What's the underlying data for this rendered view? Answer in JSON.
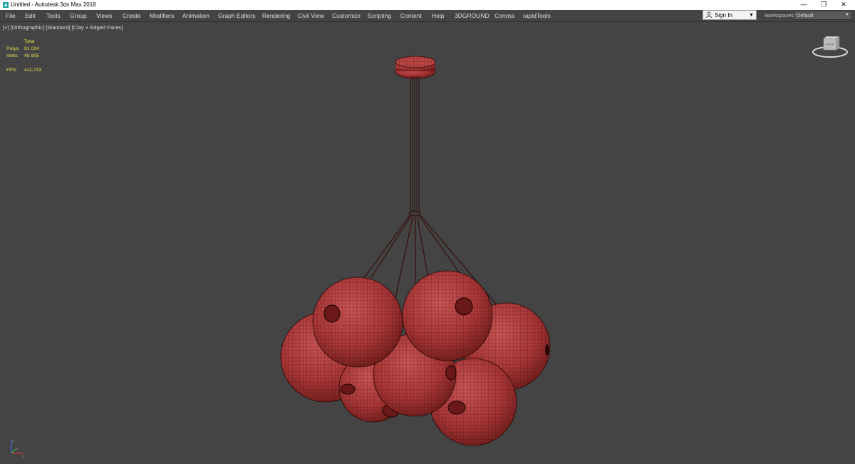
{
  "titlebar": {
    "title": "Untitled - Autodesk 3ds Max 2018",
    "minimize_glyph": "—",
    "restore_glyph": "❐",
    "close_glyph": "✕"
  },
  "menu": {
    "items": [
      "File",
      "Edit",
      "Tools",
      "Group",
      "Views",
      "Create",
      "Modifiers",
      "Animation",
      "Graph Editors",
      "Rendering",
      "Civil View",
      "Customize",
      "Scripting",
      "Content",
      "Help",
      "3DGROUND",
      "Corona",
      "rapidTools"
    ]
  },
  "signin": {
    "label": "Sign In"
  },
  "workspaces": {
    "label": "Workspaces:",
    "value": "Default"
  },
  "viewport": {
    "labels": [
      "[+]",
      "[Orthographic]",
      "[Standard]",
      "[Clay + Edged Faces]"
    ],
    "stats": {
      "header": "Total",
      "polys_label": "Polys:",
      "polys_value": "91 024",
      "verts_label": "Verts:",
      "verts_value": "45 905",
      "fps_label": "FPS:",
      "fps_value": "411,743"
    },
    "viewcube_face": "FRONT",
    "axis": {
      "x": "x",
      "y": "y",
      "z": "z"
    }
  },
  "colors": {
    "viewport_bg": "#444444",
    "model_fill": "#b03a3a",
    "model_wire": "#3a0a0a",
    "stats_text": "#e9e44e"
  },
  "icons": [
    "app-icon",
    "user-icon",
    "chevron-down-icon",
    "viewcube-icon",
    "axis-tripod-icon"
  ]
}
